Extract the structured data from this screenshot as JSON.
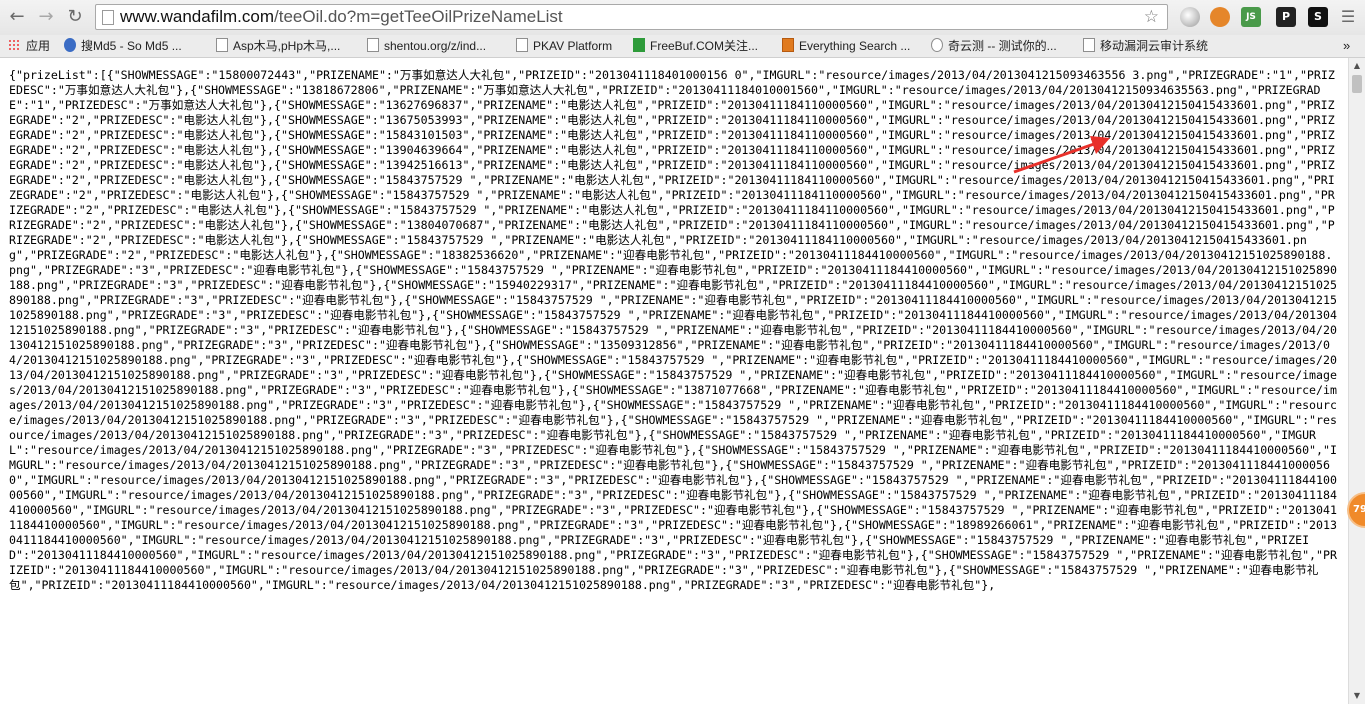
{
  "browser": {
    "url_host": "www.wandafilm.com",
    "url_path": "/teeOil.do?m=getTeeOilPrizeNameList",
    "back_icon": "arrow-left-icon",
    "forward_icon": "arrow-right-icon",
    "reload_icon": "reload-icon",
    "bookmark_icon": "star-icon",
    "extension_js_label": "JS",
    "extension_p_label": "P",
    "extension_s_label": "S",
    "menu_icon": "menu-icon"
  },
  "bookmarks": [
    {
      "label": "应用",
      "icon": "apps-icon"
    },
    {
      "label": "搜Md5 - So Md5 ...",
      "icon": "md5-icon"
    },
    {
      "label": "Asp木马,pHp木马,...",
      "icon": "page-icon"
    },
    {
      "label": "shentou.org/z/ind...",
      "icon": "page-icon"
    },
    {
      "label": "PKAV Platform",
      "icon": "page-icon"
    },
    {
      "label": "FreeBuf.COM关注...",
      "icon": "freebuf-icon"
    },
    {
      "label": "Everything Search ...",
      "icon": "everything-icon"
    },
    {
      "label": "奇云测 -- 测试你的...",
      "icon": "qiyunce-icon"
    },
    {
      "label": "移动漏洞云审计系统",
      "icon": "page-icon"
    }
  ],
  "badge_value": "79",
  "colors": {
    "arrow": "#e8302a",
    "badge": "#f08a2a"
  },
  "response_text": "{\"prizeList\":[{\"SHOWMESSAGE\":\"15800072443\",\"PRIZENAME\":\"万事如意达人大礼包\",\"PRIZEID\":\"2013041118401000156 0\",\"IMGURL\":\"resource/images/2013/04/2013041215093463556 3.png\",\"PRIZEGRADE\":\"1\",\"PRIZEDESC\":\"万事如意达人大礼包\"},{\"SHOWMESSAGE\":\"13818672806\",\"PRIZENAME\":\"万事如意达人大礼包\",\"PRIZEID\":\"20130411184010001560\",\"IMGURL\":\"resource/images/2013/04/20130412150934635563.png\",\"PRIZEGRADE\":\"1\",\"PRIZEDESC\":\"万事如意达人大礼包\"},{\"SHOWMESSAGE\":\"13627696837\",\"PRIZENAME\":\"电影达人礼包\",\"PRIZEID\":\"20130411184110000560\",\"IMGURL\":\"resource/images/2013/04/20130412150415433601.png\",\"PRIZEGRADE\":\"2\",\"PRIZEDESC\":\"电影达人礼包\"},{\"SHOWMESSAGE\":\"13675053993\",\"PRIZENAME\":\"电影达人礼包\",\"PRIZEID\":\"20130411184110000560\",\"IMGURL\":\"resource/images/2013/04/20130412150415433601.png\",\"PRIZEGRADE\":\"2\",\"PRIZEDESC\":\"电影达人礼包\"},{\"SHOWMESSAGE\":\"15843101503\",\"PRIZENAME\":\"电影达人礼包\",\"PRIZEID\":\"20130411184110000560\",\"IMGURL\":\"resource/images/2013/04/20130412150415433601.png\",\"PRIZEGRADE\":\"2\",\"PRIZEDESC\":\"电影达人礼包\"},{\"SHOWMESSAGE\":\"13904639664\",\"PRIZENAME\":\"电影达人礼包\",\"PRIZEID\":\"20130411184110000560\",\"IMGURL\":\"resource/images/2013/04/20130412150415433601.png\",\"PRIZEGRADE\":\"2\",\"PRIZEDESC\":\"电影达人礼包\"},{\"SHOWMESSAGE\":\"13942516613\",\"PRIZENAME\":\"电影达人礼包\",\"PRIZEID\":\"20130411184110000560\",\"IMGURL\":\"resource/images/2013/04/20130412150415433601.png\",\"PRIZEGRADE\":\"2\",\"PRIZEDESC\":\"电影达人礼包\"},{\"SHOWMESSAGE\":\"15843757529 \",\"PRIZENAME\":\"电影达人礼包\",\"PRIZEID\":\"20130411184110000560\",\"IMGURL\":\"resource/images/2013/04/20130412150415433601.png\",\"PRIZEGRADE\":\"2\",\"PRIZEDESC\":\"电影达人礼包\"},{\"SHOWMESSAGE\":\"15843757529 \",\"PRIZENAME\":\"电影达人礼包\",\"PRIZEID\":\"20130411184110000560\",\"IMGURL\":\"resource/images/2013/04/20130412150415433601.png\",\"PRIZEGRADE\":\"2\",\"PRIZEDESC\":\"电影达人礼包\"},{\"SHOWMESSAGE\":\"15843757529 \",\"PRIZENAME\":\"电影达人礼包\",\"PRIZEID\":\"20130411184110000560\",\"IMGURL\":\"resource/images/2013/04/20130412150415433601.png\",\"PRIZEGRADE\":\"2\",\"PRIZEDESC\":\"电影达人礼包\"},{\"SHOWMESSAGE\":\"13804070687\",\"PRIZENAME\":\"电影达人礼包\",\"PRIZEID\":\"20130411184110000560\",\"IMGURL\":\"resource/images/2013/04/20130412150415433601.png\",\"PRIZEGRADE\":\"2\",\"PRIZEDESC\":\"电影达人礼包\"},{\"SHOWMESSAGE\":\"15843757529 \",\"PRIZENAME\":\"电影达人礼包\",\"PRIZEID\":\"20130411184110000560\",\"IMGURL\":\"resource/images/2013/04/20130412150415433601.png\",\"PRIZEGRADE\":\"2\",\"PRIZEDESC\":\"电影达人礼包\"},{\"SHOWMESSAGE\":\"18382536620\",\"PRIZENAME\":\"迎春电影节礼包\",\"PRIZEID\":\"20130411184410000560\",\"IMGURL\":\"resource/images/2013/04/20130412151025890188.png\",\"PRIZEGRADE\":\"3\",\"PRIZEDESC\":\"迎春电影节礼包\"},{\"SHOWMESSAGE\":\"15843757529 \",\"PRIZENAME\":\"迎春电影节礼包\",\"PRIZEID\":\"20130411184410000560\",\"IMGURL\":\"resource/images/2013/04/20130412151025890188.png\",\"PRIZEGRADE\":\"3\",\"PRIZEDESC\":\"迎春电影节礼包\"},{\"SHOWMESSAGE\":\"15940229317\",\"PRIZENAME\":\"迎春电影节礼包\",\"PRIZEID\":\"20130411184410000560\",\"IMGURL\":\"resource/images/2013/04/20130412151025890188.png\",\"PRIZEGRADE\":\"3\",\"PRIZEDESC\":\"迎春电影节礼包\"},{\"SHOWMESSAGE\":\"15843757529 \",\"PRIZENAME\":\"迎春电影节礼包\",\"PRIZEID\":\"20130411184410000560\",\"IMGURL\":\"resource/images/2013/04/20130412151025890188.png\",\"PRIZEGRADE\":\"3\",\"PRIZEDESC\":\"迎春电影节礼包\"},{\"SHOWMESSAGE\":\"15843757529 \",\"PRIZENAME\":\"迎春电影节礼包\",\"PRIZEID\":\"20130411184410000560\",\"IMGURL\":\"resource/images/2013/04/20130412151025890188.png\",\"PRIZEGRADE\":\"3\",\"PRIZEDESC\":\"迎春电影节礼包\"},{\"SHOWMESSAGE\":\"15843757529 \",\"PRIZENAME\":\"迎春电影节礼包\",\"PRIZEID\":\"20130411184410000560\",\"IMGURL\":\"resource/images/2013/04/20130412151025890188.png\",\"PRIZEGRADE\":\"3\",\"PRIZEDESC\":\"迎春电影节礼包\"},{\"SHOWMESSAGE\":\"13509312856\",\"PRIZENAME\":\"迎春电影节礼包\",\"PRIZEID\":\"20130411184410000560\",\"IMGURL\":\"resource/images/2013/04/20130412151025890188.png\",\"PRIZEGRADE\":\"3\",\"PRIZEDESC\":\"迎春电影节礼包\"},{\"SHOWMESSAGE\":\"15843757529 \",\"PRIZENAME\":\"迎春电影节礼包\",\"PRIZEID\":\"20130411184410000560\",\"IMGURL\":\"resource/images/2013/04/20130412151025890188.png\",\"PRIZEGRADE\":\"3\",\"PRIZEDESC\":\"迎春电影节礼包\"},{\"SHOWMESSAGE\":\"15843757529 \",\"PRIZENAME\":\"迎春电影节礼包\",\"PRIZEID\":\"20130411184410000560\",\"IMGURL\":\"resource/images/2013/04/20130412151025890188.png\",\"PRIZEGRADE\":\"3\",\"PRIZEDESC\":\"迎春电影节礼包\"},{\"SHOWMESSAGE\":\"13871077668\",\"PRIZENAME\":\"迎春电影节礼包\",\"PRIZEID\":\"20130411184410000560\",\"IMGURL\":\"resource/images/2013/04/20130412151025890188.png\",\"PRIZEGRADE\":\"3\",\"PRIZEDESC\":\"迎春电影节礼包\"},{\"SHOWMESSAGE\":\"15843757529 \",\"PRIZENAME\":\"迎春电影节礼包\",\"PRIZEID\":\"20130411184410000560\",\"IMGURL\":\"resource/images/2013/04/20130412151025890188.png\",\"PRIZEGRADE\":\"3\",\"PRIZEDESC\":\"迎春电影节礼包\"},{\"SHOWMESSAGE\":\"15843757529 \",\"PRIZENAME\":\"迎春电影节礼包\",\"PRIZEID\":\"20130411184410000560\",\"IMGURL\":\"resource/images/2013/04/20130412151025890188.png\",\"PRIZEGRADE\":\"3\",\"PRIZEDESC\":\"迎春电影节礼包\"},{\"SHOWMESSAGE\":\"15843757529 \",\"PRIZENAME\":\"迎春电影节礼包\",\"PRIZEID\":\"20130411184410000560\",\"IMGURL\":\"resource/images/2013/04/20130412151025890188.png\",\"PRIZEGRADE\":\"3\",\"PRIZEDESC\":\"迎春电影节礼包\"},{\"SHOWMESSAGE\":\"15843757529 \",\"PRIZENAME\":\"迎春电影节礼包\",\"PRIZEID\":\"20130411184410000560\",\"IMGURL\":\"resource/images/2013/04/20130412151025890188.png\",\"PRIZEGRADE\":\"3\",\"PRIZEDESC\":\"迎春电影节礼包\"},{\"SHOWMESSAGE\":\"15843757529 \",\"PRIZENAME\":\"迎春电影节礼包\",\"PRIZEID\":\"20130411184410000560\",\"IMGURL\":\"resource/images/2013/04/20130412151025890188.png\",\"PRIZEGRADE\":\"3\",\"PRIZEDESC\":\"迎春电影节礼包\"},{\"SHOWMESSAGE\":\"15843757529 \",\"PRIZENAME\":\"迎春电影节礼包\",\"PRIZEID\":\"20130411184410000560\",\"IMGURL\":\"resource/images/2013/04/20130412151025890188.png\",\"PRIZEGRADE\":\"3\",\"PRIZEDESC\":\"迎春电影节礼包\"},{\"SHOWMESSAGE\":\"15843757529 \",\"PRIZENAME\":\"迎春电影节礼包\",\"PRIZEID\":\"20130411184410000560\",\"IMGURL\":\"resource/images/2013/04/20130412151025890188.png\",\"PRIZEGRADE\":\"3\",\"PRIZEDESC\":\"迎春电影节礼包\"},{\"SHOWMESSAGE\":\"15843757529 \",\"PRIZENAME\":\"迎春电影节礼包\",\"PRIZEID\":\"20130411184410000560\",\"IMGURL\":\"resource/images/2013/04/20130412151025890188.png\",\"PRIZEGRADE\":\"3\",\"PRIZEDESC\":\"迎春电影节礼包\"},{\"SHOWMESSAGE\":\"18989266061\",\"PRIZENAME\":\"迎春电影节礼包\",\"PRIZEID\":\"20130411184410000560\",\"IMGURL\":\"resource/images/2013/04/20130412151025890188.png\",\"PRIZEGRADE\":\"3\",\"PRIZEDESC\":\"迎春电影节礼包\"},{\"SHOWMESSAGE\":\"15843757529 \",\"PRIZENAME\":\"迎春电影节礼包\",\"PRIZEID\":\"20130411184410000560\",\"IMGURL\":\"resource/images/2013/04/20130412151025890188.png\",\"PRIZEGRADE\":\"3\",\"PRIZEDESC\":\"迎春电影节礼包\"},{\"SHOWMESSAGE\":\"15843757529 \",\"PRIZENAME\":\"迎春电影节礼包\",\"PRIZEID\":\"20130411184410000560\",\"IMGURL\":\"resource/images/2013/04/20130412151025890188.png\",\"PRIZEGRADE\":\"3\",\"PRIZEDESC\":\"迎春电影节礼包\"},{\"SHOWMESSAGE\":\"15843757529 \",\"PRIZENAME\":\"迎春电影节礼包\",\"PRIZEID\":\"20130411184410000560\",\"IMGURL\":\"resource/images/2013/04/20130412151025890188.png\",\"PRIZEGRADE\":\"3\",\"PRIZEDESC\":\"迎春电影节礼包\"},"
}
